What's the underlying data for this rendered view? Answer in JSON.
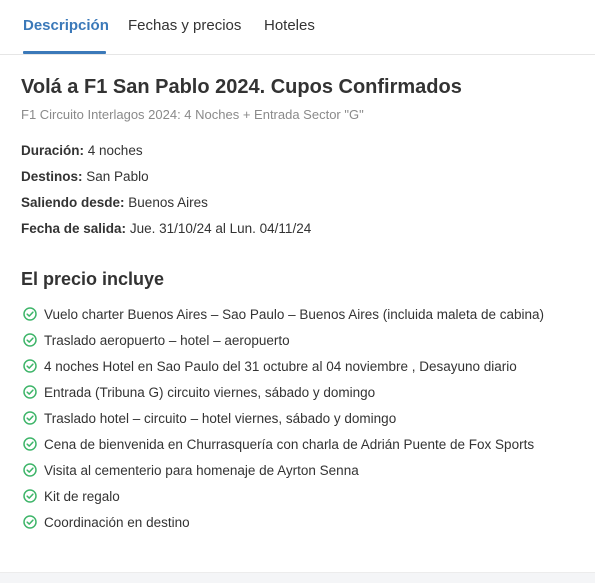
{
  "tabs": [
    {
      "label": "Descripción",
      "active": true
    },
    {
      "label": "Fechas y precios",
      "active": false
    },
    {
      "label": "Hoteles",
      "active": false
    }
  ],
  "title": "Volá a F1 San Pablo 2024. Cupos Confirmados",
  "subtitle": "F1 Circuito Interlagos 2024: 4 Noches + Entrada Sector \"G\"",
  "details": [
    {
      "label": "Duración:",
      "value": "4 noches"
    },
    {
      "label": "Destinos:",
      "value": "San Pablo"
    },
    {
      "label": "Saliendo desde:",
      "value": "Buenos Aires"
    },
    {
      "label": "Fecha de salida:",
      "value": "Jue. 31/10/24 al Lun. 04/11/24"
    }
  ],
  "includes": {
    "title": "El precio incluye",
    "items": [
      "Vuelo charter Buenos Aires – Sao Paulo – Buenos Aires (incluida maleta de cabina)",
      "Traslado aeropuerto – hotel – aeropuerto",
      "4 noches Hotel en Sao Paulo del 31 octubre al 04 noviembre , Desayuno diario",
      "Entrada (Tribuna G) circuito viernes, sábado y domingo",
      "Traslado hotel – circuito – hotel viernes, sábado y domingo",
      "Cena de bienvenida en Churrasquería con charla de Adrián Puente de Fox Sports",
      "Visita al cementerio para homenaje de Ayrton Senna",
      "Kit de regalo",
      "Coordinación en destino"
    ],
    "icon": "check-circle-icon"
  },
  "colors": {
    "accent": "#3b79b9",
    "check": "#3fb56a",
    "muted": "#8a8a8a",
    "text": "#333333"
  }
}
